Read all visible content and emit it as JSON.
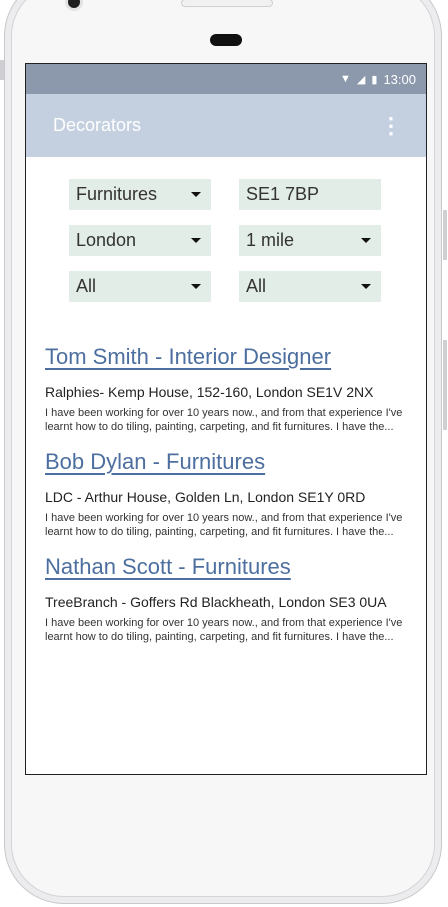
{
  "status_bar": {
    "time": "13:00"
  },
  "app_bar": {
    "title": "Decorators"
  },
  "filters": {
    "category": "Furnitures",
    "postcode": "SE1 7BP",
    "city": "London",
    "radius": "1 mile",
    "filter_a": "All",
    "filter_b": "All"
  },
  "results": [
    {
      "title": "Tom Smith - Interior Designer",
      "address": "Ralphies- Kemp House, 152-160,  London SE1V 2NX",
      "description": "I have been working for over 10 years now., and from that experience I've learnt how to do tiling, painting, carpeting, and fit furnitures. I have the..."
    },
    {
      "title": "Bob Dylan - Furnitures",
      "address": "LDC - Arthur House, Golden Ln,  London SE1Y 0RD",
      "description": "I have been working for over 10 years now., and from that experience I've learnt how to do tiling, painting, carpeting, and fit furnitures. I have the..."
    },
    {
      "title": "Nathan Scott - Furnitures",
      "address": "TreeBranch - Goffers Rd Blackheath, London SE3 0UA",
      "description": "I have been working for over 10 years now., and from that experience I've learnt how to do tiling, painting, carpeting, and fit furnitures. I have the..."
    }
  ]
}
